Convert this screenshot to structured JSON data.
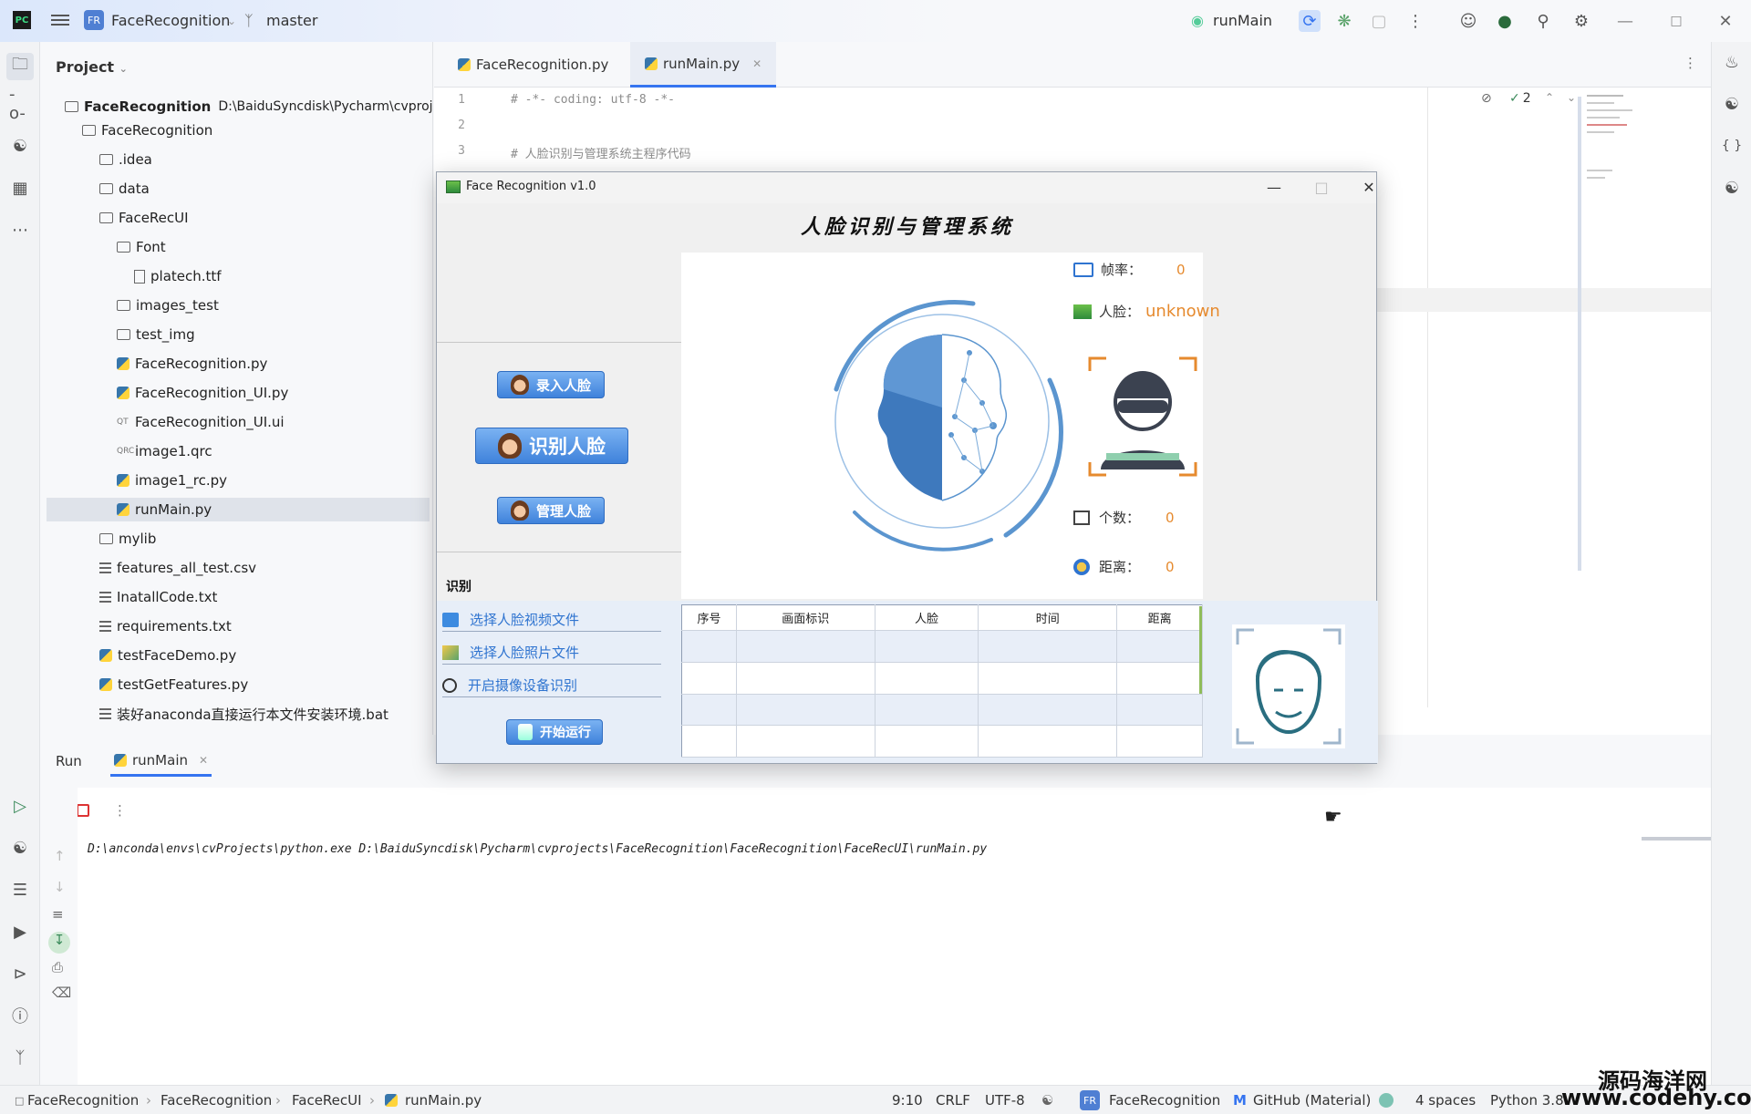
{
  "titlebar": {
    "badge": "FR",
    "project": "FaceRecognition",
    "branch": "master",
    "run_config": "runMain",
    "logo": "PC"
  },
  "project_panel": {
    "title": "Project",
    "root_name": "FaceRecognition",
    "root_path": "D:\\BaiduSyncdisk\\Pycharm\\cvprojects",
    "items": [
      {
        "label": "FaceRecognition",
        "type": "folder",
        "depth": 1
      },
      {
        "label": ".idea",
        "type": "folder",
        "depth": 2
      },
      {
        "label": "data",
        "type": "folder",
        "depth": 2
      },
      {
        "label": "FaceRecUI",
        "type": "folder",
        "depth": 2
      },
      {
        "label": "Font",
        "type": "folder",
        "depth": 3
      },
      {
        "label": "platech.ttf",
        "type": "file",
        "depth": 4
      },
      {
        "label": "images_test",
        "type": "folder",
        "depth": 3
      },
      {
        "label": "test_img",
        "type": "folder",
        "depth": 3
      },
      {
        "label": "FaceRecognition.py",
        "type": "py",
        "depth": 3
      },
      {
        "label": "FaceRecognition_UI.py",
        "type": "py",
        "depth": 3
      },
      {
        "label": "FaceRecognition_UI.ui",
        "type": "qt",
        "depth": 3,
        "tag": "QT"
      },
      {
        "label": "image1.qrc",
        "type": "qrc",
        "depth": 3,
        "tag": "QRC"
      },
      {
        "label": "image1_rc.py",
        "type": "py",
        "depth": 3
      },
      {
        "label": "runMain.py",
        "type": "py",
        "depth": 3,
        "selected": true
      },
      {
        "label": "mylib",
        "type": "folder",
        "depth": 2
      },
      {
        "label": "features_all_test.csv",
        "type": "txt",
        "depth": 2
      },
      {
        "label": "InatallCode.txt",
        "type": "txt",
        "depth": 2
      },
      {
        "label": "requirements.txt",
        "type": "txt",
        "depth": 2
      },
      {
        "label": "testFaceDemo.py",
        "type": "py",
        "depth": 2
      },
      {
        "label": "testGetFeatures.py",
        "type": "py",
        "depth": 2
      },
      {
        "label": "装好anaconda直接运行本文件安装环境.bat",
        "type": "txt",
        "depth": 2
      }
    ]
  },
  "editor": {
    "tabs": [
      {
        "label": "FaceRecognition.py",
        "active": false
      },
      {
        "label": "runMain.py",
        "active": true
      }
    ],
    "line_numbers": [
      "1",
      "2",
      "3"
    ],
    "lines": [
      "# -*- coding: utf-8 -*-",
      "",
      "# 人脸识别与管理系统主程序代码"
    ],
    "inspection_count": "2"
  },
  "app_window": {
    "title": "Face Recognition v1.0",
    "heading": "人脸识别与管理系统",
    "buttons": {
      "enroll": "录入人脸",
      "recognize": "识别人脸",
      "manage": "管理人脸",
      "start": "开始运行"
    },
    "section_label": "识别",
    "sources": [
      "选择人脸视频文件",
      "选择人脸照片文件",
      "开启摄像设备识别"
    ],
    "info": {
      "fps_label": "帧率：",
      "fps_value": "0",
      "face_label": "人脸：",
      "face_value": "unknown",
      "count_label": "个数：",
      "count_value": "0",
      "dist_label": "距离：",
      "dist_value": "0"
    },
    "table": {
      "headers": [
        "序号",
        "画面标识",
        "人脸",
        "时间",
        "距离"
      ],
      "rows": [
        [
          "",
          "",
          "",
          "",
          ""
        ],
        [
          "",
          "",
          "",
          "",
          ""
        ],
        [
          "",
          "",
          "",
          "",
          ""
        ],
        [
          "",
          "",
          "",
          "",
          ""
        ]
      ]
    }
  },
  "run_panel": {
    "title": "Run",
    "tab": "runMain",
    "console": "D:\\anconda\\envs\\cvProjects\\python.exe D:\\BaiduSyncdisk\\Pycharm\\cvprojects\\FaceRecognition\\FaceRecognition\\FaceRecUI\\runMain.py"
  },
  "status_bar": {
    "breadcrumbs": [
      "FaceRecognition",
      "FaceRecognition",
      "FaceRecUI",
      "runMain.py"
    ],
    "position": "9:10",
    "line_sep": "CRLF",
    "encoding": "UTF-8",
    "project": "FaceRecognition",
    "theme": "GitHub (Material)",
    "indent": "4 spaces",
    "interpreter": "Python 3.8",
    "watermark_cn": "源码海洋网",
    "watermark_url": "www.codehy.com"
  },
  "colors": {
    "accent": "#3574f0",
    "orange": "#e68a2e",
    "link_blue": "#2f74d0"
  }
}
